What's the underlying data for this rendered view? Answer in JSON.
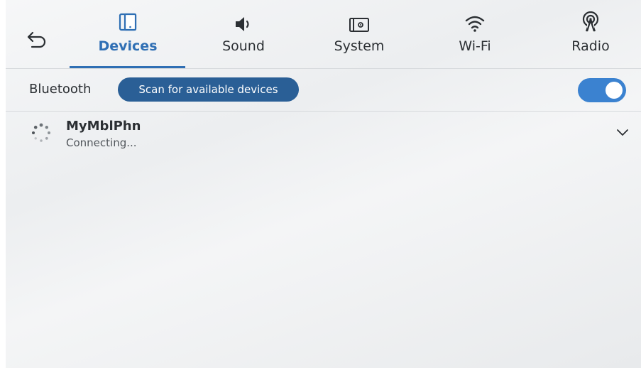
{
  "nav": {
    "back_icon": "back-arrow-icon",
    "tabs": [
      {
        "label": "Devices",
        "icon": "phone-icon",
        "active": true
      },
      {
        "label": "Sound",
        "icon": "speaker-icon",
        "active": false
      },
      {
        "label": "System",
        "icon": "system-icon",
        "active": false
      },
      {
        "label": "Wi-Fi",
        "icon": "wifi-icon",
        "active": false
      },
      {
        "label": "Radio",
        "icon": "radio-antenna-icon",
        "active": false
      }
    ]
  },
  "bluetooth": {
    "label": "Bluetooth",
    "scan_label": "Scan for available devices",
    "enabled": true
  },
  "devices": [
    {
      "name": "MyMblPhn",
      "status": "Connecting...",
      "icon": "loading-spinner-icon"
    }
  ],
  "colors": {
    "accent": "#2f6fb4",
    "scan_button": "#2a5f96",
    "toggle_on": "#3b82d0",
    "text": "#2b2f33"
  }
}
